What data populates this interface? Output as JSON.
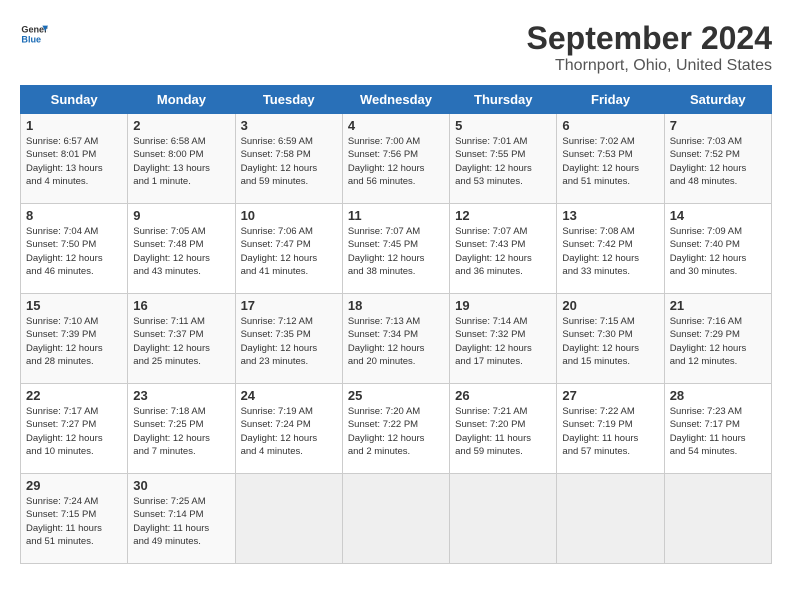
{
  "header": {
    "logo_line1": "General",
    "logo_line2": "Blue",
    "month": "September 2024",
    "location": "Thornport, Ohio, United States"
  },
  "weekdays": [
    "Sunday",
    "Monday",
    "Tuesday",
    "Wednesday",
    "Thursday",
    "Friday",
    "Saturday"
  ],
  "weeks": [
    [
      {
        "num": "1",
        "lines": [
          "Sunrise: 6:57 AM",
          "Sunset: 8:01 PM",
          "Daylight: 13 hours",
          "and 4 minutes."
        ]
      },
      {
        "num": "2",
        "lines": [
          "Sunrise: 6:58 AM",
          "Sunset: 8:00 PM",
          "Daylight: 13 hours",
          "and 1 minute."
        ]
      },
      {
        "num": "3",
        "lines": [
          "Sunrise: 6:59 AM",
          "Sunset: 7:58 PM",
          "Daylight: 12 hours",
          "and 59 minutes."
        ]
      },
      {
        "num": "4",
        "lines": [
          "Sunrise: 7:00 AM",
          "Sunset: 7:56 PM",
          "Daylight: 12 hours",
          "and 56 minutes."
        ]
      },
      {
        "num": "5",
        "lines": [
          "Sunrise: 7:01 AM",
          "Sunset: 7:55 PM",
          "Daylight: 12 hours",
          "and 53 minutes."
        ]
      },
      {
        "num": "6",
        "lines": [
          "Sunrise: 7:02 AM",
          "Sunset: 7:53 PM",
          "Daylight: 12 hours",
          "and 51 minutes."
        ]
      },
      {
        "num": "7",
        "lines": [
          "Sunrise: 7:03 AM",
          "Sunset: 7:52 PM",
          "Daylight: 12 hours",
          "and 48 minutes."
        ]
      }
    ],
    [
      {
        "num": "8",
        "lines": [
          "Sunrise: 7:04 AM",
          "Sunset: 7:50 PM",
          "Daylight: 12 hours",
          "and 46 minutes."
        ]
      },
      {
        "num": "9",
        "lines": [
          "Sunrise: 7:05 AM",
          "Sunset: 7:48 PM",
          "Daylight: 12 hours",
          "and 43 minutes."
        ]
      },
      {
        "num": "10",
        "lines": [
          "Sunrise: 7:06 AM",
          "Sunset: 7:47 PM",
          "Daylight: 12 hours",
          "and 41 minutes."
        ]
      },
      {
        "num": "11",
        "lines": [
          "Sunrise: 7:07 AM",
          "Sunset: 7:45 PM",
          "Daylight: 12 hours",
          "and 38 minutes."
        ]
      },
      {
        "num": "12",
        "lines": [
          "Sunrise: 7:07 AM",
          "Sunset: 7:43 PM",
          "Daylight: 12 hours",
          "and 36 minutes."
        ]
      },
      {
        "num": "13",
        "lines": [
          "Sunrise: 7:08 AM",
          "Sunset: 7:42 PM",
          "Daylight: 12 hours",
          "and 33 minutes."
        ]
      },
      {
        "num": "14",
        "lines": [
          "Sunrise: 7:09 AM",
          "Sunset: 7:40 PM",
          "Daylight: 12 hours",
          "and 30 minutes."
        ]
      }
    ],
    [
      {
        "num": "15",
        "lines": [
          "Sunrise: 7:10 AM",
          "Sunset: 7:39 PM",
          "Daylight: 12 hours",
          "and 28 minutes."
        ]
      },
      {
        "num": "16",
        "lines": [
          "Sunrise: 7:11 AM",
          "Sunset: 7:37 PM",
          "Daylight: 12 hours",
          "and 25 minutes."
        ]
      },
      {
        "num": "17",
        "lines": [
          "Sunrise: 7:12 AM",
          "Sunset: 7:35 PM",
          "Daylight: 12 hours",
          "and 23 minutes."
        ]
      },
      {
        "num": "18",
        "lines": [
          "Sunrise: 7:13 AM",
          "Sunset: 7:34 PM",
          "Daylight: 12 hours",
          "and 20 minutes."
        ]
      },
      {
        "num": "19",
        "lines": [
          "Sunrise: 7:14 AM",
          "Sunset: 7:32 PM",
          "Daylight: 12 hours",
          "and 17 minutes."
        ]
      },
      {
        "num": "20",
        "lines": [
          "Sunrise: 7:15 AM",
          "Sunset: 7:30 PM",
          "Daylight: 12 hours",
          "and 15 minutes."
        ]
      },
      {
        "num": "21",
        "lines": [
          "Sunrise: 7:16 AM",
          "Sunset: 7:29 PM",
          "Daylight: 12 hours",
          "and 12 minutes."
        ]
      }
    ],
    [
      {
        "num": "22",
        "lines": [
          "Sunrise: 7:17 AM",
          "Sunset: 7:27 PM",
          "Daylight: 12 hours",
          "and 10 minutes."
        ]
      },
      {
        "num": "23",
        "lines": [
          "Sunrise: 7:18 AM",
          "Sunset: 7:25 PM",
          "Daylight: 12 hours",
          "and 7 minutes."
        ]
      },
      {
        "num": "24",
        "lines": [
          "Sunrise: 7:19 AM",
          "Sunset: 7:24 PM",
          "Daylight: 12 hours",
          "and 4 minutes."
        ]
      },
      {
        "num": "25",
        "lines": [
          "Sunrise: 7:20 AM",
          "Sunset: 7:22 PM",
          "Daylight: 12 hours",
          "and 2 minutes."
        ]
      },
      {
        "num": "26",
        "lines": [
          "Sunrise: 7:21 AM",
          "Sunset: 7:20 PM",
          "Daylight: 11 hours",
          "and 59 minutes."
        ]
      },
      {
        "num": "27",
        "lines": [
          "Sunrise: 7:22 AM",
          "Sunset: 7:19 PM",
          "Daylight: 11 hours",
          "and 57 minutes."
        ]
      },
      {
        "num": "28",
        "lines": [
          "Sunrise: 7:23 AM",
          "Sunset: 7:17 PM",
          "Daylight: 11 hours",
          "and 54 minutes."
        ]
      }
    ],
    [
      {
        "num": "29",
        "lines": [
          "Sunrise: 7:24 AM",
          "Sunset: 7:15 PM",
          "Daylight: 11 hours",
          "and 51 minutes."
        ]
      },
      {
        "num": "30",
        "lines": [
          "Sunrise: 7:25 AM",
          "Sunset: 7:14 PM",
          "Daylight: 11 hours",
          "and 49 minutes."
        ]
      },
      {
        "num": "",
        "lines": []
      },
      {
        "num": "",
        "lines": []
      },
      {
        "num": "",
        "lines": []
      },
      {
        "num": "",
        "lines": []
      },
      {
        "num": "",
        "lines": []
      }
    ]
  ]
}
